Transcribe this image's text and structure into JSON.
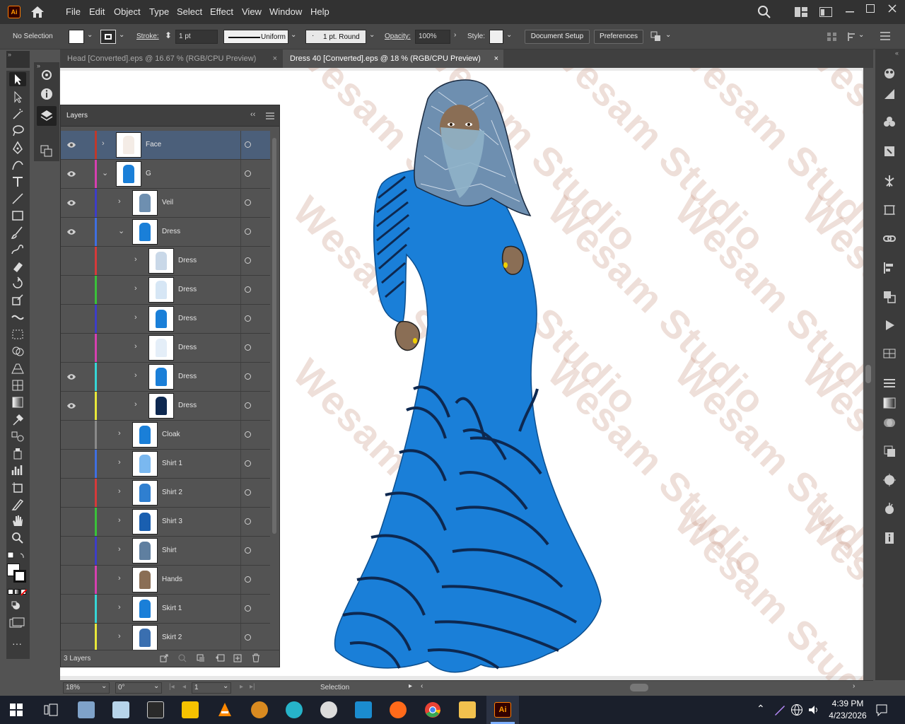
{
  "app": {
    "logo": "Ai"
  },
  "menu": [
    "File",
    "Edit",
    "Object",
    "Type",
    "Select",
    "Effect",
    "View",
    "Window",
    "Help"
  ],
  "control": {
    "selection": "No Selection",
    "stroke_label": "Stroke:",
    "stroke_value": "1 pt",
    "profile": "Uniform",
    "brush": "1 pt. Round",
    "opacity_label": "Opacity:",
    "opacity_value": "100%",
    "style_label": "Style:",
    "doc_setup": "Document Setup",
    "preferences": "Preferences"
  },
  "tabs": [
    {
      "label": "Head [Converted].eps @ 16.67 % (RGB/CPU Preview)",
      "active": false
    },
    {
      "label": "Dress 40 [Converted].eps @ 18 % (RGB/CPU Preview)",
      "active": true
    }
  ],
  "layers_panel": {
    "title": "Layers",
    "footer": "3 Layers",
    "rows": [
      {
        "name": "Face",
        "color": "#c0392b",
        "visible": true,
        "selected": true
      },
      {
        "name": "G",
        "color": "#d63fb0",
        "visible": true
      },
      {
        "name": "Veil",
        "color": "#3d3dc8",
        "visible": true
      },
      {
        "name": "Dress",
        "color": "#3f6fe0",
        "visible": true
      },
      {
        "name": "Dress",
        "color": "#d63a3a",
        "visible": false
      },
      {
        "name": "Dress",
        "color": "#39c339",
        "visible": false
      },
      {
        "name": "Dress",
        "color": "#3d3dc8",
        "visible": false
      },
      {
        "name": "Dress",
        "color": "#d63fb0",
        "visible": false
      },
      {
        "name": "Dress",
        "color": "#36d6d6",
        "visible": true
      },
      {
        "name": "Dress",
        "color": "#e8e83a",
        "visible": true
      },
      {
        "name": "Cloak",
        "color": "#8a8a8a",
        "visible": false
      },
      {
        "name": "Shirt 1",
        "color": "#3f6fe0",
        "visible": false
      },
      {
        "name": "Shirt 2",
        "color": "#d63a3a",
        "visible": false
      },
      {
        "name": "Shirt 3",
        "color": "#39c339",
        "visible": false
      },
      {
        "name": "Shirt",
        "color": "#3d3dc8",
        "visible": false
      },
      {
        "name": "Hands",
        "color": "#d63fb0",
        "visible": false
      },
      {
        "name": "Skirt 1",
        "color": "#36d6d6",
        "visible": false
      },
      {
        "name": "Skirt 2",
        "color": "#e8e83a",
        "visible": false
      }
    ]
  },
  "status": {
    "zoom": "18%",
    "rotation": "0°",
    "artboard": "1",
    "tool": "Selection"
  },
  "watermark": "Wesam Studio",
  "taskbar": {
    "time": "4:39 PM",
    "date": "4/23/2026"
  },
  "colors": {
    "dress": "#1a7fd8",
    "accent": "#ff7c00"
  }
}
